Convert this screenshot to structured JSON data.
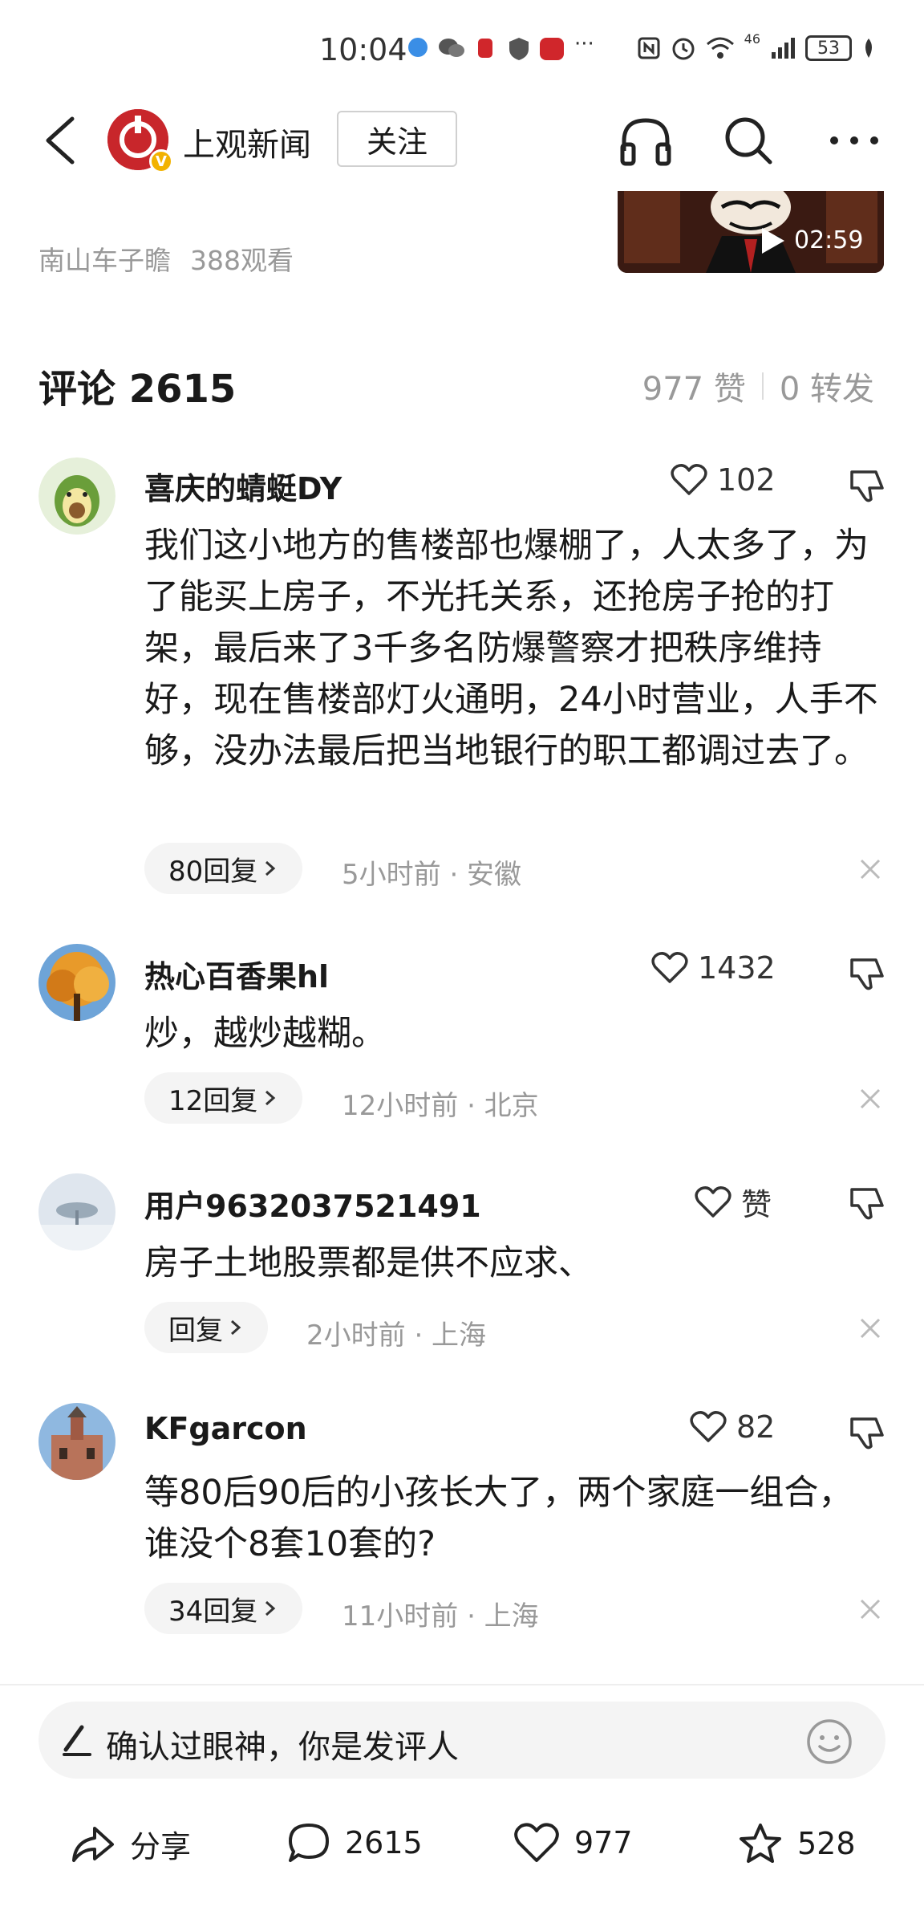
{
  "status_bar": {
    "time": "10:04",
    "network": "46",
    "battery": "53",
    "more": "···"
  },
  "header": {
    "logo_letter": "V",
    "channel_name": "上观新闻",
    "follow_label": "关注"
  },
  "video": {
    "author": "南山车子瞻",
    "views": "388观看",
    "duration": "02:59"
  },
  "comments_header": {
    "title": "评论 2615",
    "likes": "977 赞",
    "shares": "0 转发"
  },
  "comments": [
    {
      "username": "喜庆的蜻蜓DY",
      "likes": "102",
      "text": "我们这小地方的售楼部也爆棚了，人太多了，为了能买上房子，不光托关系，还抢房子抢的打架，最后来了3千多名防爆警察才把秩序维持好，现在售楼部灯火通明，24小时营业，人手不够，没办法最后把当地银行的职工都调过去了。",
      "replies": "80回复",
      "meta": "5小时前 · 安徽"
    },
    {
      "username": "热心百香果hl",
      "likes": "1432",
      "text": "炒，越炒越糊。",
      "replies": "12回复",
      "meta": "12小时前 · 北京"
    },
    {
      "username": "用户9632037521491",
      "likes": "赞",
      "text": "房子土地股票都是供不应求、",
      "replies": "回复",
      "meta": "2小时前 · 上海"
    },
    {
      "username": "KFgarcon",
      "likes": "82",
      "text": "等80后90后的小孩长大了，两个家庭一组合，谁没个8套10套的?",
      "replies": "34回复",
      "meta": "11小时前 · 上海"
    }
  ],
  "bottom": {
    "placeholder": "确认过眼神，你是发评人",
    "share_label": "分享",
    "comment_count": "2615",
    "like_count": "977",
    "star_count": "528"
  },
  "colors": {
    "brand_red": "#c8262b",
    "badge_gold": "#f2b200",
    "muted": "#999999"
  }
}
